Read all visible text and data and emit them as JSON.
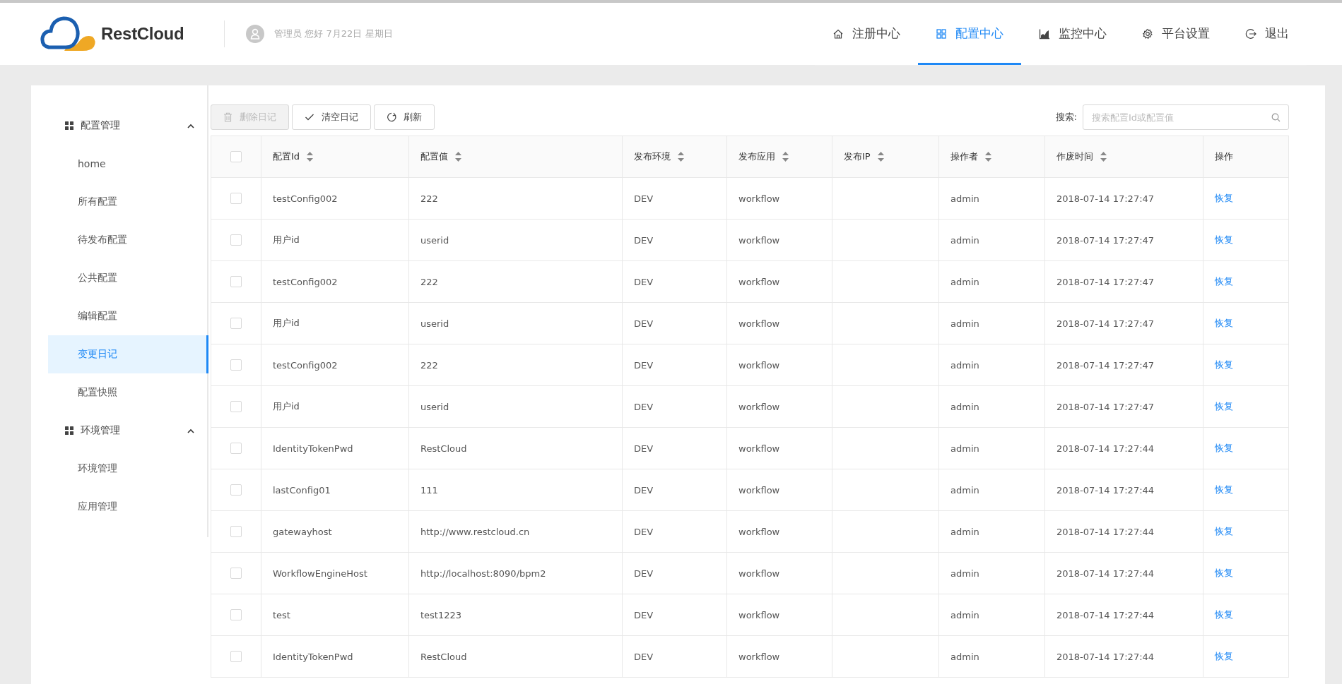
{
  "header": {
    "logo_text": "RestCloud",
    "greeting": "管理员 您好 7月22日 星期日",
    "nav": [
      {
        "label": "注册中心",
        "selected": false
      },
      {
        "label": "配置中心",
        "selected": true
      },
      {
        "label": "监控中心",
        "selected": false
      },
      {
        "label": "平台设置",
        "selected": false
      },
      {
        "label": "退出",
        "selected": false
      }
    ]
  },
  "sidebar": {
    "groups": [
      {
        "label": "配置管理",
        "expanded": true,
        "items": [
          {
            "label": "home",
            "selected": false
          },
          {
            "label": "所有配置",
            "selected": false
          },
          {
            "label": "待发布配置",
            "selected": false
          },
          {
            "label": "公共配置",
            "selected": false
          },
          {
            "label": "编辑配置",
            "selected": false
          },
          {
            "label": "变更日记",
            "selected": true
          },
          {
            "label": "配置快照",
            "selected": false
          }
        ]
      },
      {
        "label": "环境管理",
        "expanded": true,
        "items": [
          {
            "label": "环境管理",
            "selected": false
          },
          {
            "label": "应用管理",
            "selected": false
          }
        ]
      }
    ]
  },
  "toolbar": {
    "buttons": [
      {
        "label": "删除日记",
        "disabled": true
      },
      {
        "label": "清空日记",
        "disabled": false
      },
      {
        "label": "刷新",
        "disabled": false
      }
    ],
    "search_label": "搜索:",
    "search_placeholder": "搜索配置Id或配置值"
  },
  "table": {
    "select_all_checked": false,
    "columns": [
      {
        "label": "配置Id",
        "sortable": true
      },
      {
        "label": "配置值",
        "sortable": true
      },
      {
        "label": "发布环境",
        "sortable": true
      },
      {
        "label": "发布应用",
        "sortable": true
      },
      {
        "label": "发布IP",
        "sortable": true
      },
      {
        "label": "操作者",
        "sortable": true
      },
      {
        "label": "作废时间",
        "sortable": true
      },
      {
        "label": "操作",
        "sortable": false
      }
    ],
    "rows": [
      {
        "checked": false,
        "cells": [
          "testConfig002",
          "222",
          "DEV",
          "workflow",
          "",
          "admin",
          "2018-07-14 17:27:47"
        ],
        "action": "恢复"
      },
      {
        "checked": false,
        "cells": [
          "用户id",
          "userid",
          "DEV",
          "workflow",
          "",
          "admin",
          "2018-07-14 17:27:47"
        ],
        "action": "恢复"
      },
      {
        "checked": false,
        "cells": [
          "testConfig002",
          "222",
          "DEV",
          "workflow",
          "",
          "admin",
          "2018-07-14 17:27:47"
        ],
        "action": "恢复"
      },
      {
        "checked": false,
        "cells": [
          "用户id",
          "userid",
          "DEV",
          "workflow",
          "",
          "admin",
          "2018-07-14 17:27:47"
        ],
        "action": "恢复"
      },
      {
        "checked": false,
        "cells": [
          "testConfig002",
          "222",
          "DEV",
          "workflow",
          "",
          "admin",
          "2018-07-14 17:27:47"
        ],
        "action": "恢复"
      },
      {
        "checked": false,
        "cells": [
          "用户id",
          "userid",
          "DEV",
          "workflow",
          "",
          "admin",
          "2018-07-14 17:27:47"
        ],
        "action": "恢复"
      },
      {
        "checked": false,
        "cells": [
          "IdentityTokenPwd",
          "RestCloud",
          "DEV",
          "workflow",
          "",
          "admin",
          "2018-07-14 17:27:44"
        ],
        "action": "恢复"
      },
      {
        "checked": false,
        "cells": [
          "lastConfig01",
          "111",
          "DEV",
          "workflow",
          "",
          "admin",
          "2018-07-14 17:27:44"
        ],
        "action": "恢复"
      },
      {
        "checked": false,
        "cells": [
          "gatewayhost",
          "http://www.restcloud.cn",
          "DEV",
          "workflow",
          "",
          "admin",
          "2018-07-14 17:27:44"
        ],
        "action": "恢复"
      },
      {
        "checked": false,
        "cells": [
          "WorkflowEngineHost",
          "http://localhost:8090/bpm2",
          "DEV",
          "workflow",
          "",
          "admin",
          "2018-07-14 17:27:44"
        ],
        "action": "恢复"
      },
      {
        "checked": false,
        "cells": [
          "test",
          "test1223",
          "DEV",
          "workflow",
          "",
          "admin",
          "2018-07-14 17:27:44"
        ],
        "action": "恢复"
      },
      {
        "checked": false,
        "cells": [
          "IdentityTokenPwd",
          "RestCloud",
          "DEV",
          "workflow",
          "",
          "admin",
          "2018-07-14 17:27:44"
        ],
        "action": "恢复"
      }
    ]
  }
}
